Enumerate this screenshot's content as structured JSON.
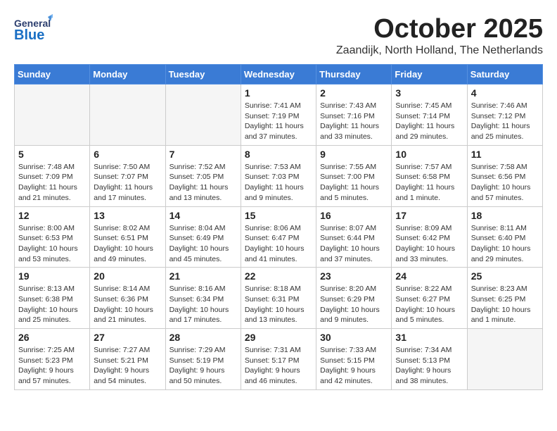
{
  "header": {
    "logo_general": "General",
    "logo_blue": "Blue",
    "month_title": "October 2025",
    "location": "Zaandijk, North Holland, The Netherlands"
  },
  "weekdays": [
    "Sunday",
    "Monday",
    "Tuesday",
    "Wednesday",
    "Thursday",
    "Friday",
    "Saturday"
  ],
  "weeks": [
    [
      {
        "day": "",
        "info": ""
      },
      {
        "day": "",
        "info": ""
      },
      {
        "day": "",
        "info": ""
      },
      {
        "day": "1",
        "info": "Sunrise: 7:41 AM\nSunset: 7:19 PM\nDaylight: 11 hours\nand 37 minutes."
      },
      {
        "day": "2",
        "info": "Sunrise: 7:43 AM\nSunset: 7:16 PM\nDaylight: 11 hours\nand 33 minutes."
      },
      {
        "day": "3",
        "info": "Sunrise: 7:45 AM\nSunset: 7:14 PM\nDaylight: 11 hours\nand 29 minutes."
      },
      {
        "day": "4",
        "info": "Sunrise: 7:46 AM\nSunset: 7:12 PM\nDaylight: 11 hours\nand 25 minutes."
      }
    ],
    [
      {
        "day": "5",
        "info": "Sunrise: 7:48 AM\nSunset: 7:09 PM\nDaylight: 11 hours\nand 21 minutes."
      },
      {
        "day": "6",
        "info": "Sunrise: 7:50 AM\nSunset: 7:07 PM\nDaylight: 11 hours\nand 17 minutes."
      },
      {
        "day": "7",
        "info": "Sunrise: 7:52 AM\nSunset: 7:05 PM\nDaylight: 11 hours\nand 13 minutes."
      },
      {
        "day": "8",
        "info": "Sunrise: 7:53 AM\nSunset: 7:03 PM\nDaylight: 11 hours\nand 9 minutes."
      },
      {
        "day": "9",
        "info": "Sunrise: 7:55 AM\nSunset: 7:00 PM\nDaylight: 11 hours\nand 5 minutes."
      },
      {
        "day": "10",
        "info": "Sunrise: 7:57 AM\nSunset: 6:58 PM\nDaylight: 11 hours\nand 1 minute."
      },
      {
        "day": "11",
        "info": "Sunrise: 7:58 AM\nSunset: 6:56 PM\nDaylight: 10 hours\nand 57 minutes."
      }
    ],
    [
      {
        "day": "12",
        "info": "Sunrise: 8:00 AM\nSunset: 6:53 PM\nDaylight: 10 hours\nand 53 minutes."
      },
      {
        "day": "13",
        "info": "Sunrise: 8:02 AM\nSunset: 6:51 PM\nDaylight: 10 hours\nand 49 minutes."
      },
      {
        "day": "14",
        "info": "Sunrise: 8:04 AM\nSunset: 6:49 PM\nDaylight: 10 hours\nand 45 minutes."
      },
      {
        "day": "15",
        "info": "Sunrise: 8:06 AM\nSunset: 6:47 PM\nDaylight: 10 hours\nand 41 minutes."
      },
      {
        "day": "16",
        "info": "Sunrise: 8:07 AM\nSunset: 6:44 PM\nDaylight: 10 hours\nand 37 minutes."
      },
      {
        "day": "17",
        "info": "Sunrise: 8:09 AM\nSunset: 6:42 PM\nDaylight: 10 hours\nand 33 minutes."
      },
      {
        "day": "18",
        "info": "Sunrise: 8:11 AM\nSunset: 6:40 PM\nDaylight: 10 hours\nand 29 minutes."
      }
    ],
    [
      {
        "day": "19",
        "info": "Sunrise: 8:13 AM\nSunset: 6:38 PM\nDaylight: 10 hours\nand 25 minutes."
      },
      {
        "day": "20",
        "info": "Sunrise: 8:14 AM\nSunset: 6:36 PM\nDaylight: 10 hours\nand 21 minutes."
      },
      {
        "day": "21",
        "info": "Sunrise: 8:16 AM\nSunset: 6:34 PM\nDaylight: 10 hours\nand 17 minutes."
      },
      {
        "day": "22",
        "info": "Sunrise: 8:18 AM\nSunset: 6:31 PM\nDaylight: 10 hours\nand 13 minutes."
      },
      {
        "day": "23",
        "info": "Sunrise: 8:20 AM\nSunset: 6:29 PM\nDaylight: 10 hours\nand 9 minutes."
      },
      {
        "day": "24",
        "info": "Sunrise: 8:22 AM\nSunset: 6:27 PM\nDaylight: 10 hours\nand 5 minutes."
      },
      {
        "day": "25",
        "info": "Sunrise: 8:23 AM\nSunset: 6:25 PM\nDaylight: 10 hours\nand 1 minute."
      }
    ],
    [
      {
        "day": "26",
        "info": "Sunrise: 7:25 AM\nSunset: 5:23 PM\nDaylight: 9 hours\nand 57 minutes."
      },
      {
        "day": "27",
        "info": "Sunrise: 7:27 AM\nSunset: 5:21 PM\nDaylight: 9 hours\nand 54 minutes."
      },
      {
        "day": "28",
        "info": "Sunrise: 7:29 AM\nSunset: 5:19 PM\nDaylight: 9 hours\nand 50 minutes."
      },
      {
        "day": "29",
        "info": "Sunrise: 7:31 AM\nSunset: 5:17 PM\nDaylight: 9 hours\nand 46 minutes."
      },
      {
        "day": "30",
        "info": "Sunrise: 7:33 AM\nSunset: 5:15 PM\nDaylight: 9 hours\nand 42 minutes."
      },
      {
        "day": "31",
        "info": "Sunrise: 7:34 AM\nSunset: 5:13 PM\nDaylight: 9 hours\nand 38 minutes."
      },
      {
        "day": "",
        "info": ""
      }
    ]
  ]
}
